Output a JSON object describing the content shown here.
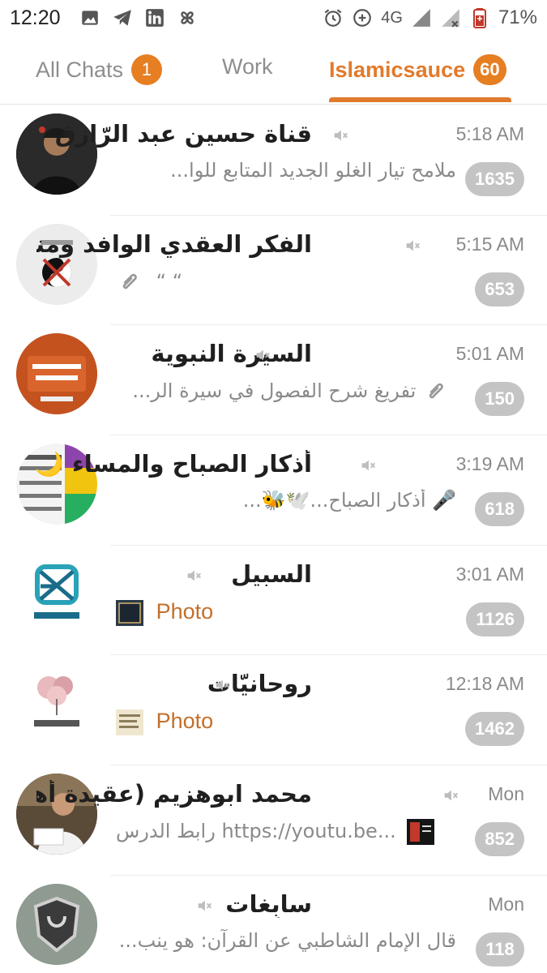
{
  "statusbar": {
    "time": "12:20",
    "network": "4G",
    "battery": "71%",
    "left_icons": [
      "image-icon",
      "telegram-icon",
      "linkedin-icon",
      "pinwheel-icon"
    ],
    "right_icons": [
      "alarm-icon",
      "data-saver-icon",
      "signal-icon",
      "signal-off-icon",
      "battery-icon"
    ]
  },
  "tabs": [
    {
      "label": "All Chats",
      "badge": "1",
      "active": false
    },
    {
      "label": "Work",
      "badge": "",
      "active": false
    },
    {
      "label": "Islamicsauce",
      "badge": "60",
      "active": true
    }
  ],
  "colors": {
    "accent": "#e07a2c",
    "badge_muted": "#c4c4c4"
  },
  "chats": [
    {
      "title": "قناة حسين عبد الرّازق",
      "time": "5:18 AM",
      "preview": "ملامح تيار الغلو الجديد   المتابع للوا...",
      "count": "1635"
    },
    {
      "title": "الفكر العقدي الوافد ومنهجي...",
      "time": "5:15 AM",
      "preview": "“   “",
      "count": "653",
      "preview_icon": "paperclip-icon"
    },
    {
      "title": "السيرة النبوية",
      "time": "5:01 AM",
      "preview": "تفريغ شرح الفصول في سيرة الر...",
      "count": "150",
      "preview_icon": "paperclip-icon"
    },
    {
      "title": "أذكار الصباح والمساء 🌙",
      "time": "3:19 AM",
      "preview": "🎤 أذكار الصباح...🕊️🐝...",
      "count": "618"
    },
    {
      "title": "السبيل",
      "time": "3:01 AM",
      "preview": "Photo",
      "count": "1126"
    },
    {
      "title": "روحانيّات",
      "time": "12:18 AM",
      "preview": "Photo",
      "count": "1462"
    },
    {
      "title": "محمد ابوهزيم (عقيدة أهل السن...",
      "time": "Mon",
      "preview": "رابط الدرس https://youtu.be...",
      "count": "852"
    },
    {
      "title": "سابِغات",
      "time": "Mon",
      "preview": "قال الإمام الشاطبي عن القرآن:  هو ينب...",
      "count": "118"
    }
  ]
}
